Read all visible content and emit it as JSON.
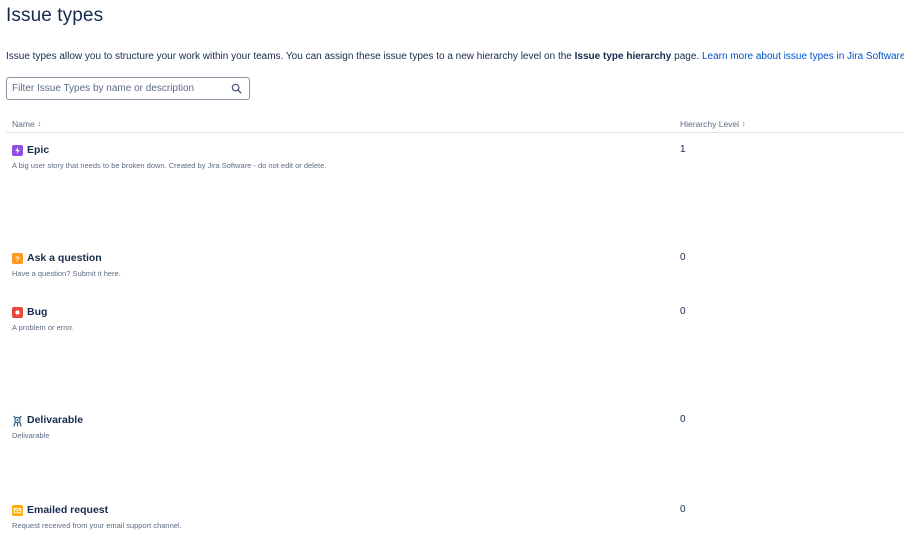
{
  "page": {
    "title": "Issue types",
    "intro": {
      "text_before": "Issue types allow you to structure your work within your teams. You can assign these issue types to a new hierarchy level on the ",
      "bold": "Issue type hierarchy",
      "text_after": " page. ",
      "link": "Learn more about issue types in Jira Software"
    },
    "filter": {
      "placeholder": "Filter Issue Types by name or description",
      "value": ""
    },
    "columns": {
      "name": "Name",
      "hierarchy_level": "Hierarchy Level"
    },
    "issue_types": [
      {
        "name": "Epic",
        "description": "A big user story that needs to be broken down. Created by Jira Software - do not edit or delete.",
        "level": "1",
        "icon": "epic-icon",
        "color": "#904ee2"
      },
      {
        "name": "Ask a question",
        "description": "Have a question? Submit it here.",
        "level": "0",
        "icon": "question-icon",
        "color": "#ff991f"
      },
      {
        "name": "Bug",
        "description": "A problem or error.",
        "level": "0",
        "icon": "bug-icon",
        "color": "#e5493a"
      },
      {
        "name": "Delivarable",
        "description": "Delivarable",
        "level": "0",
        "icon": "deliverable-icon",
        "color": "#2a5f88"
      },
      {
        "name": "Emailed request",
        "description": "Request received from your email support channel.",
        "level": "0",
        "icon": "email-icon",
        "color": "#ffab00"
      }
    ]
  }
}
